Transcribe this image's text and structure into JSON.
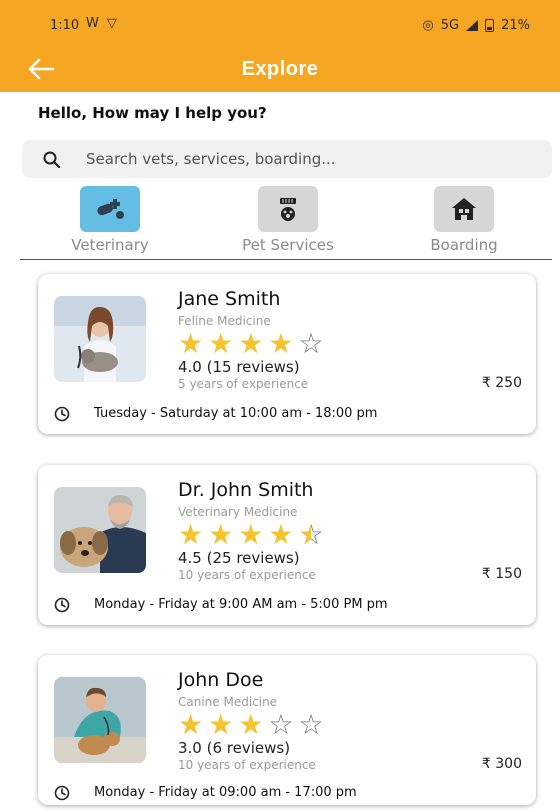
{
  "status_bar": {
    "time": "1:10",
    "network": "5G",
    "battery": "21%"
  },
  "header": {
    "title": "Explore",
    "back_icon": "arrow-left-icon"
  },
  "greeting": "Hello, How may I help you?",
  "search": {
    "placeholder": "Search vets, services, boarding...",
    "value": "",
    "icon": "search-icon"
  },
  "categories": [
    {
      "label": "Veterinary",
      "icon": "vet-pills-icon",
      "active": true
    },
    {
      "label": "Pet Services",
      "icon": "pet-services-icon",
      "active": false
    },
    {
      "label": "Boarding",
      "icon": "house-icon",
      "active": false
    }
  ],
  "vets": [
    {
      "name": "Jane Smith",
      "specialty": "Feline Medicine",
      "rating": 4.0,
      "rating_text": "4.0 (15 reviews)",
      "experience": "5 years of experience",
      "price": "₹ 250",
      "hours": "Tuesday - Saturday at 10:00 am - 18:00 pm"
    },
    {
      "name": "Dr. John Smith",
      "specialty": "Veterinary Medicine",
      "rating": 4.5,
      "rating_text": "4.5 (25 reviews)",
      "experience": "10 years of experience",
      "price": "₹ 150",
      "hours": "Monday - Friday at 9:00 AM am - 5:00 PM pm"
    },
    {
      "name": "John Doe",
      "specialty": "Canine Medicine",
      "rating": 3.0,
      "rating_text": "3.0 (6 reviews)",
      "experience": "10 years of experience",
      "price": "₹ 300",
      "hours": "Monday - Friday at 09:00 am - 17:00 pm"
    }
  ],
  "colors": {
    "header": "#f5a623",
    "star": "#f4c430",
    "vet_category": "#64bde3"
  }
}
